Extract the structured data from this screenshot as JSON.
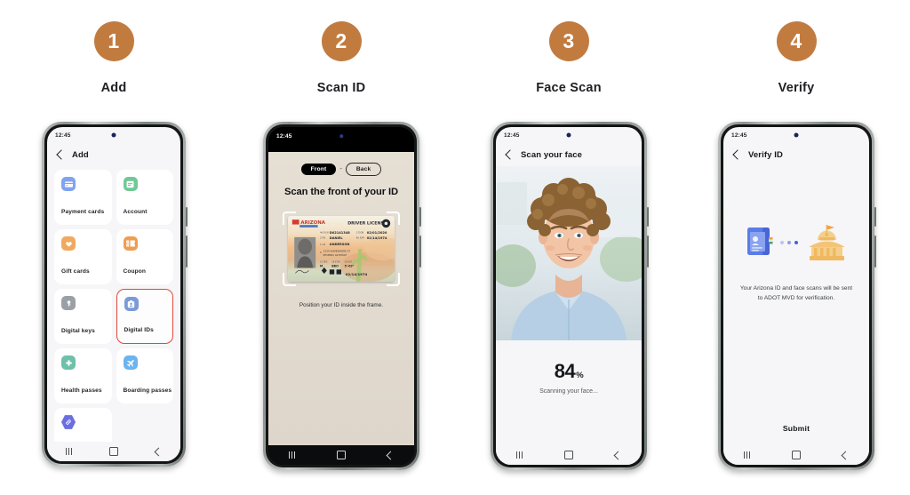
{
  "theme": {
    "step_badge_color": "#c27b3f",
    "selection_outline_color": "#e0483c",
    "phone_screen_bg": "#f6f6f8",
    "text_primary": "#15181c"
  },
  "steps": [
    {
      "number": "1",
      "label": "Add",
      "screen": {
        "status_time": "12:45",
        "app_title": "Add",
        "tiles": [
          {
            "label": "Payment cards",
            "icon": "credit-card-icon",
            "icon_bg": "#7fa3ef",
            "selected": false
          },
          {
            "label": "Account",
            "icon": "account-card-icon",
            "icon_bg": "#6fc996",
            "selected": false
          },
          {
            "label": "Gift cards",
            "icon": "gift-heart-icon",
            "icon_bg": "#f0a95e",
            "selected": false
          },
          {
            "label": "Coupon",
            "icon": "coupon-ticket-icon",
            "icon_bg": "#ef9d53",
            "selected": false
          },
          {
            "label": "Digital keys",
            "icon": "key-icon",
            "icon_bg": "#9aa0a6",
            "selected": false
          },
          {
            "label": "Digital IDs",
            "icon": "id-card-icon",
            "icon_bg": "#7b9ad8",
            "selected": true
          },
          {
            "label": "Health passes",
            "icon": "health-cross-icon",
            "icon_bg": "#6fc0ab",
            "selected": false
          },
          {
            "label": "Boarding passes",
            "icon": "airplane-icon",
            "icon_bg": "#6bb4f0",
            "selected": false
          },
          {
            "label": "",
            "icon": "link-hex-icon",
            "icon_bg": "#6b6ee0",
            "selected": false
          }
        ]
      }
    },
    {
      "number": "2",
      "label": "Scan ID",
      "screen": {
        "status_time": "12:45",
        "toggle_front": "Front",
        "toggle_separator": "-",
        "toggle_back": "Back",
        "heading": "Scan the front of your ID",
        "hint": "Position your ID inside the frame.",
        "id_card": {
          "state": "ARIZONA",
          "state_sub": "The Grand Canyon State",
          "doc_type": "DRIVER LICENSE",
          "fields": [
            {
              "key": "4d DLN",
              "value": "D02141348"
            },
            {
              "key": "3 DOB",
              "value": "02/01/2020"
            },
            {
              "key": "2 FN",
              "value": "DANIEL"
            },
            {
              "key": "4b EXP",
              "value": "02/14/1974"
            },
            {
              "key": "1 LN",
              "value": "ANDERSON"
            },
            {
              "key": "8",
              "value": "1234 SOMEWHERE ST PHOENIX AZ 85007"
            },
            {
              "key": "15 SEX",
              "value": "M"
            },
            {
              "key": "18 EYES",
              "value": "BRO"
            },
            {
              "key": "16 HGT",
              "value": "5'-09\""
            }
          ],
          "signature_date": "02/14/1974"
        }
      }
    },
    {
      "number": "3",
      "label": "Face Scan",
      "screen": {
        "status_time": "12:45",
        "app_title": "Scan your face",
        "progress_value": "84",
        "progress_unit": "%",
        "status_text": "Scanning your face..."
      }
    },
    {
      "number": "4",
      "label": "Verify",
      "screen": {
        "status_time": "12:45",
        "app_title": "Verify ID",
        "illustration": "id-document-to-government-building-icon",
        "body_text": "Your Arizona ID and face scans will be sent to ADOT MVD for verification.",
        "submit_label": "Submit"
      }
    }
  ],
  "nav": {
    "recent_icon": "recent-apps-icon",
    "home_icon": "home-icon",
    "back_icon": "back-icon"
  }
}
